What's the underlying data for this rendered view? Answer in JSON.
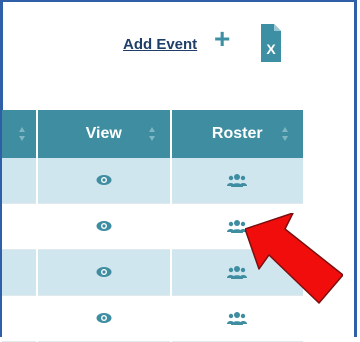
{
  "toolbar": {
    "add_event_label": "Add Event",
    "plus_icon": "plus-icon",
    "excel_icon": "excel-export-icon"
  },
  "table": {
    "columns": [
      {
        "label": ""
      },
      {
        "label": "View"
      },
      {
        "label": "Roster"
      }
    ],
    "rows": [
      {
        "view_icon": "eye-icon",
        "roster_icon": "users-icon"
      },
      {
        "view_icon": "eye-icon",
        "roster_icon": "users-icon"
      },
      {
        "view_icon": "eye-icon",
        "roster_icon": "users-icon"
      },
      {
        "view_icon": "eye-icon",
        "roster_icon": "users-icon"
      }
    ]
  },
  "colors": {
    "header": "#3e8da0",
    "row_shade": "#cfe6ef",
    "accent_plus": "#3d8fa3",
    "arrow": "#f20d0d"
  }
}
